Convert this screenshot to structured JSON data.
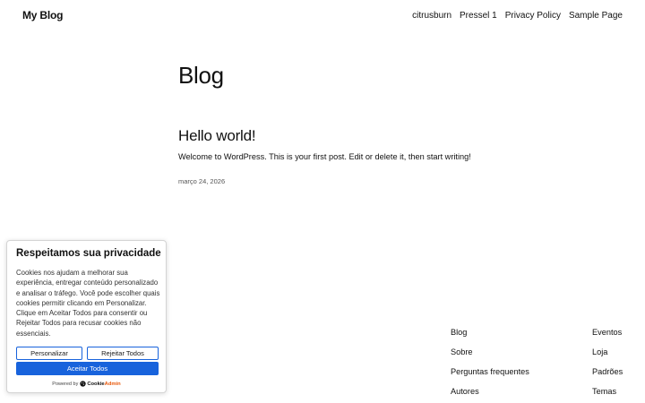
{
  "header": {
    "site_title": "My Blog",
    "nav": [
      "citrusburn",
      "Pressel 1",
      "Privacy Policy",
      "Sample Page"
    ]
  },
  "main": {
    "heading": "Blog",
    "post": {
      "title": "Hello world!",
      "excerpt": "Welcome to WordPress. This is your first post. Edit or delete it, then start writing!",
      "date": "março 24, 2026"
    }
  },
  "footer": {
    "col1": [
      "Blog",
      "Sobre",
      "Perguntas frequentes",
      "Autores"
    ],
    "col2": [
      "Eventos",
      "Loja",
      "Padrões",
      "Temas"
    ]
  },
  "cookie": {
    "title": "Respeitamos sua privacidade",
    "text_before_custom": "Cookies nos ajudam a melhorar sua experiência, entregar conteúdo personalizado e analisar o tráfego. Você pode escolher quais cookies permitir clicando em ",
    "custom_word": "Personalizar",
    "text_mid1": ". Clique em ",
    "accept_word": "Aceitar Todos",
    "text_mid2": " para consentir ou ",
    "reject_word": "Rejeitar Todos",
    "text_after": " para recusar cookies não essenciais.",
    "btn_customize": "Personalizar",
    "btn_reject": "Rejeitar Todos",
    "btn_accept": "Aceitar Todos",
    "powered_by": "Powered by",
    "brand_cookie": "Cookie",
    "brand_admin": "Admin"
  }
}
